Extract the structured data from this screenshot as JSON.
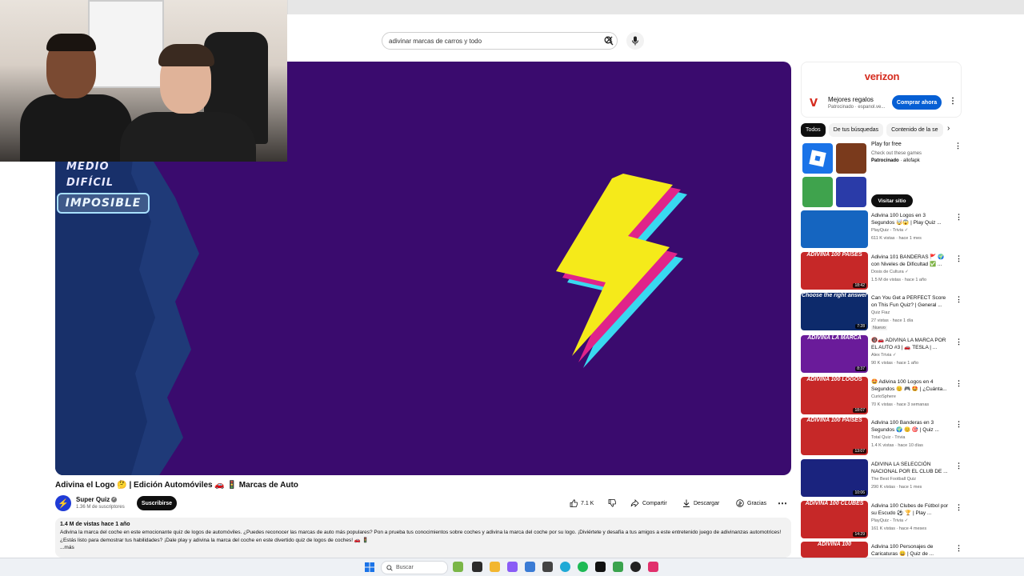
{
  "search": {
    "query": "adivinar marcas de carros y todo"
  },
  "player": {
    "levels": [
      "MEDIO",
      "DIFÍCIL",
      "IMPOSIBLE"
    ]
  },
  "video": {
    "title": "Adivina el Logo 🤔 | Edición Automóviles 🚗 🚦 Marcas de Auto",
    "channel": "Super Quiz",
    "subscribers": "1.36 M de suscriptores",
    "subscribe_label": "Suscribirse",
    "likes": "7.1 K",
    "share_label": "Compartir",
    "download_label": "Descargar",
    "thanks_label": "Gracias",
    "views_meta": "1.4 M de vistas  hace 1 año",
    "description": "Adivina la marca del coche en este emocionante quiz de logos de automóviles. ¿Puedes reconocer las marcas de auto más populares? Pon a prueba tus conocimientos sobre coches y adivina la marca del coche por su logo. ¡Diviértete y desafía a tus amigos a este entretenido juego de adivinanzas automotrices! ¿Estás listo para demostrar tus habilidades? ¡Dale play y adivina la marca del coche en este divertido quiz de logos de coches! 🚗 🚦",
    "more_label": "...más"
  },
  "ad": {
    "brand": "verizon",
    "title": "Mejores regalos",
    "sponsor": "Patrocinado · espanol.ve...",
    "buy_label": "Comprar ahora"
  },
  "chips": [
    "Todos",
    "De tus búsquedas",
    "Contenido de la se"
  ],
  "sponsored": {
    "title": "Play for free",
    "subtitle": "Check out these games",
    "label": "Patrocinado",
    "source": "· allofapk",
    "visit_label": "Visitar sitio"
  },
  "recommended": [
    {
      "title": "Adivina 100 Logos en 3 Segundos 🤯😱 | Play Quiz ...",
      "channel": "PlayQuiz - Trivia ✓",
      "meta": "611 K vistas · hace 1 mes",
      "duration": "",
      "badge": ""
    },
    {
      "title": "Adivina 101 BANDERAS 🚩 🌍 con Niveles de Dificultad ✅ ...",
      "channel": "Dosis de Cultura ✓",
      "meta": "1.5 M de vistas · hace 1 año",
      "duration": "18:42",
      "badge": ""
    },
    {
      "title": "Can You Get a PERFECT Score on This Fun Quiz? | General ...",
      "channel": "Quiz Fiaz",
      "meta": "27 vistas · hace 1 día",
      "duration": "7:28",
      "badge": "Nuevo"
    },
    {
      "title": "🔞🚗 ADIVINA LA MARCA POR EL AUTO #3 | 🚗 TESLA | ...",
      "channel": "Alex Trivia ✓",
      "meta": "90 K vistas · hace 1 año",
      "duration": "8:37",
      "badge": ""
    },
    {
      "title": "🤩 Adivina 100 Logos en 4 Segundos 😊 🎮 🤩 | ¿Cuánta...",
      "channel": "CurioSphere",
      "meta": "70 K vistas · hace 3 semanas",
      "duration": "18:07",
      "badge": ""
    },
    {
      "title": "Adivina 100 Banderas en 3 Segundos 🌍 😊 🎯 | Quiz ...",
      "channel": "Total Quiz - Trivia",
      "meta": "1.4 K vistas · hace 10 días",
      "duration": "13:07",
      "badge": ""
    },
    {
      "title": "ADIVINA LA SELECCIÓN NACIONAL POR EL CLUB DE ...",
      "channel": "The Best Football Quiz",
      "meta": "290 K vistas · hace 1 mes",
      "duration": "10:06",
      "badge": ""
    },
    {
      "title": "Adivina 100 Clubes de Fútbol por su Escudo ⚽ 🏆 | Play ...",
      "channel": "PlayQuiz - Trivia ✓",
      "meta": "161 K vistas · hace 4 meses",
      "duration": "14:29",
      "badge": ""
    },
    {
      "title": "Adivina 100 Personajes de Caricaturas 😄 | Quiz de ...",
      "channel": "",
      "meta": "",
      "duration": "",
      "badge": ""
    }
  ],
  "thumb_texts": [
    "",
    "ADIVINA 100 PAÍSES",
    "Choose the right answer",
    "ADIVINA LA MARCA",
    "ADIVINA 100 LOGOS",
    "ADIVINA 100 PAÍSES",
    "",
    "ADIVINA 100 CLUBES",
    "ADIVINA 100"
  ],
  "taskbar": {
    "search_label": "Buscar"
  },
  "colors": {
    "accent": "#065fd4",
    "player_bg": "#3a0b6e",
    "brand_red": "#d52b1e"
  }
}
